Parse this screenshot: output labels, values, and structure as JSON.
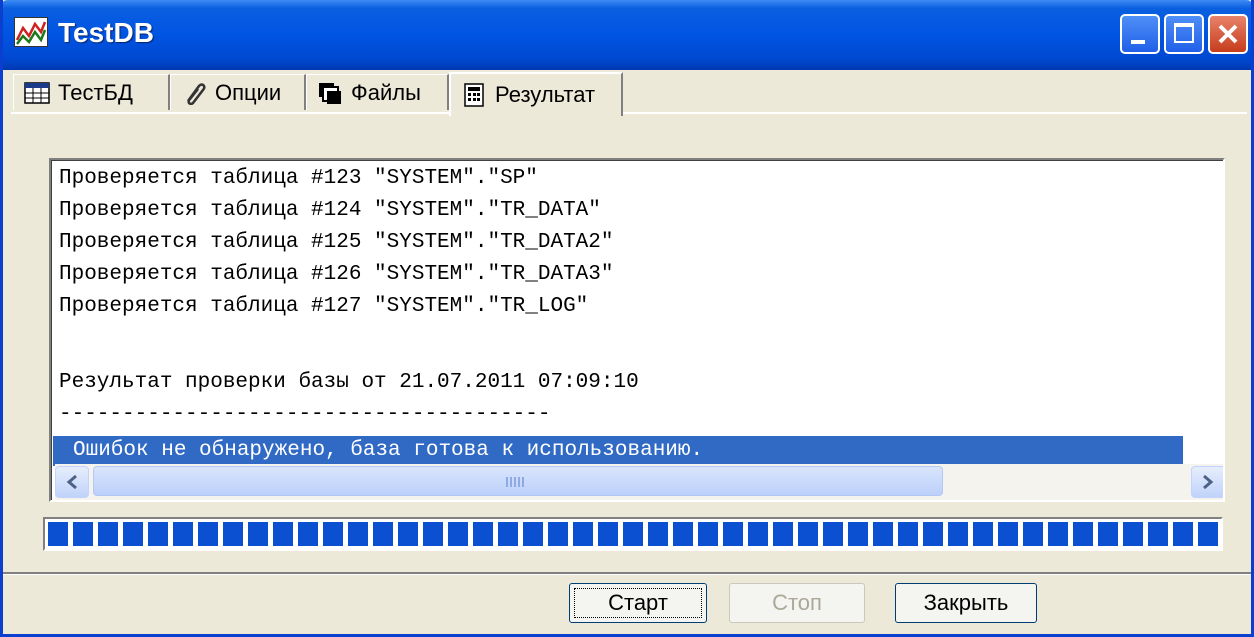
{
  "window": {
    "title": "TestDB"
  },
  "tabs": [
    {
      "label": "ТестБД",
      "icon": "table-icon"
    },
    {
      "label": "Опции",
      "icon": "paperclip-icon"
    },
    {
      "label": "Файлы",
      "icon": "files-icon"
    },
    {
      "label": "Результат",
      "icon": "report-icon"
    }
  ],
  "active_tab": "Результат",
  "log": {
    "lines": [
      "Проверяется таблица #123 \"SYSTEM\".\"SP\"",
      "Проверяется таблица #124 \"SYSTEM\".\"TR_DATA\"",
      "Проверяется таблица #125 \"SYSTEM\".\"TR_DATA2\"",
      "Проверяется таблица #126 \"SYSTEM\".\"TR_DATA3\"",
      "Проверяется таблица #127 \"SYSTEM\".\"TR_LOG\"",
      "",
      "Результат проверки базы от 21.07.2011 07:09:10",
      "---------------------------------------",
      "Ошибок не обнаружено, база готова к использованию."
    ],
    "selected_index": 8
  },
  "progress": {
    "percent": 100,
    "color": "#0a50d0"
  },
  "buttons": {
    "start_label": "Старт",
    "stop_label": "Стоп",
    "close_label": "Закрыть"
  }
}
